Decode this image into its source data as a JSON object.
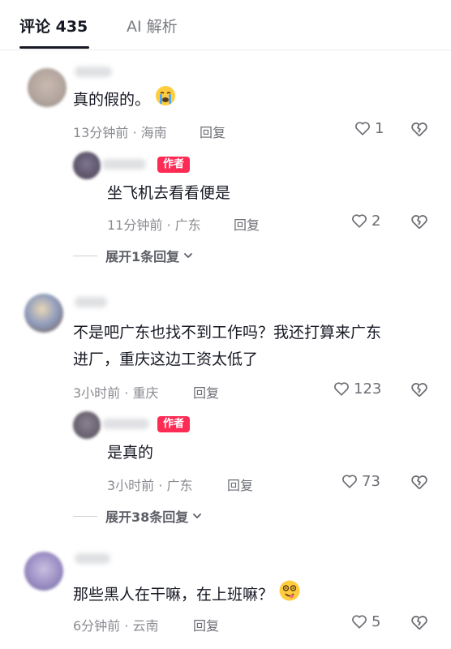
{
  "tabs": [
    {
      "label": "评论 435"
    },
    {
      "label": "AI 解析"
    }
  ],
  "colors": {
    "author_badge": "#fe2c55",
    "text": "#161823",
    "meta": "#8a8b91"
  },
  "comments": [
    {
      "text": "真的假的。",
      "emoji": "crying-face-icon",
      "meta": "13分钟前 · 海南",
      "reply": "回复",
      "likes": "1",
      "replies": [
        {
          "badge": "作者",
          "text": "坐飞机去看看便是",
          "meta": "11分钟前 · 广东",
          "reply": "回复",
          "likes": "2"
        }
      ],
      "expand": "展开1条回复"
    },
    {
      "text_line1": "不是吧广东也找不到工作吗？我还打算来广东",
      "text_line2": "进厂，重庆这边工资太低了",
      "meta": "3小时前 · 重庆",
      "reply": "回复",
      "likes": "123",
      "replies": [
        {
          "badge": "作者",
          "text": "是真的",
          "meta": "3小时前 · 广东",
          "reply": "回复",
          "likes": "73"
        }
      ],
      "expand": "展开38条回复"
    },
    {
      "text": "那些黑人在干嘛，在上班嘛？",
      "emoji": "dizzy-face-icon",
      "meta": "6分钟前 · 云南",
      "reply": "回复",
      "likes": "5"
    }
  ]
}
